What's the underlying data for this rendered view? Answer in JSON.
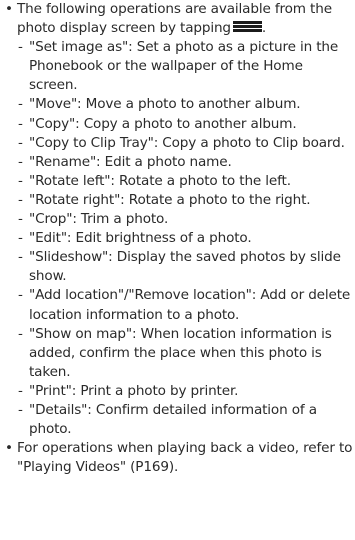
{
  "bullet_symbol": "•",
  "dash_symbol": "-",
  "section1": {
    "intro": "The following operations are available from the photo display screen by tapping",
    "intro_end": ".",
    "menu_icon": "menu-icon",
    "items": [
      "\"Set image as\": Set a photo as a picture in the Phonebook or the wallpaper of the Home screen.",
      "\"Move\": Move a photo to another album.",
      "\"Copy\": Copy a photo to another album.",
      "\"Copy to Clip Tray\": Copy a photo to Clip board.",
      "\"Rename\": Edit a photo name.",
      "\"Rotate left\": Rotate a photo to the left.",
      "\"Rotate right\": Rotate a photo to the right.",
      "\"Crop\": Trim a photo.",
      "\"Edit\": Edit brightness of a photo.",
      "\"Slideshow\": Display the saved photos by slide show.",
      "\"Add location\"/\"Remove location\": Add or delete location information to a photo.",
      "\"Show on map\": When location information is added, confirm the place when this photo is taken.",
      "\"Print\": Print a photo by printer.",
      "\"Details\": Confirm detailed information of a photo."
    ]
  },
  "section2": {
    "text": "For operations when playing back a video, refer to \"Playing Videos\" (P169)."
  }
}
